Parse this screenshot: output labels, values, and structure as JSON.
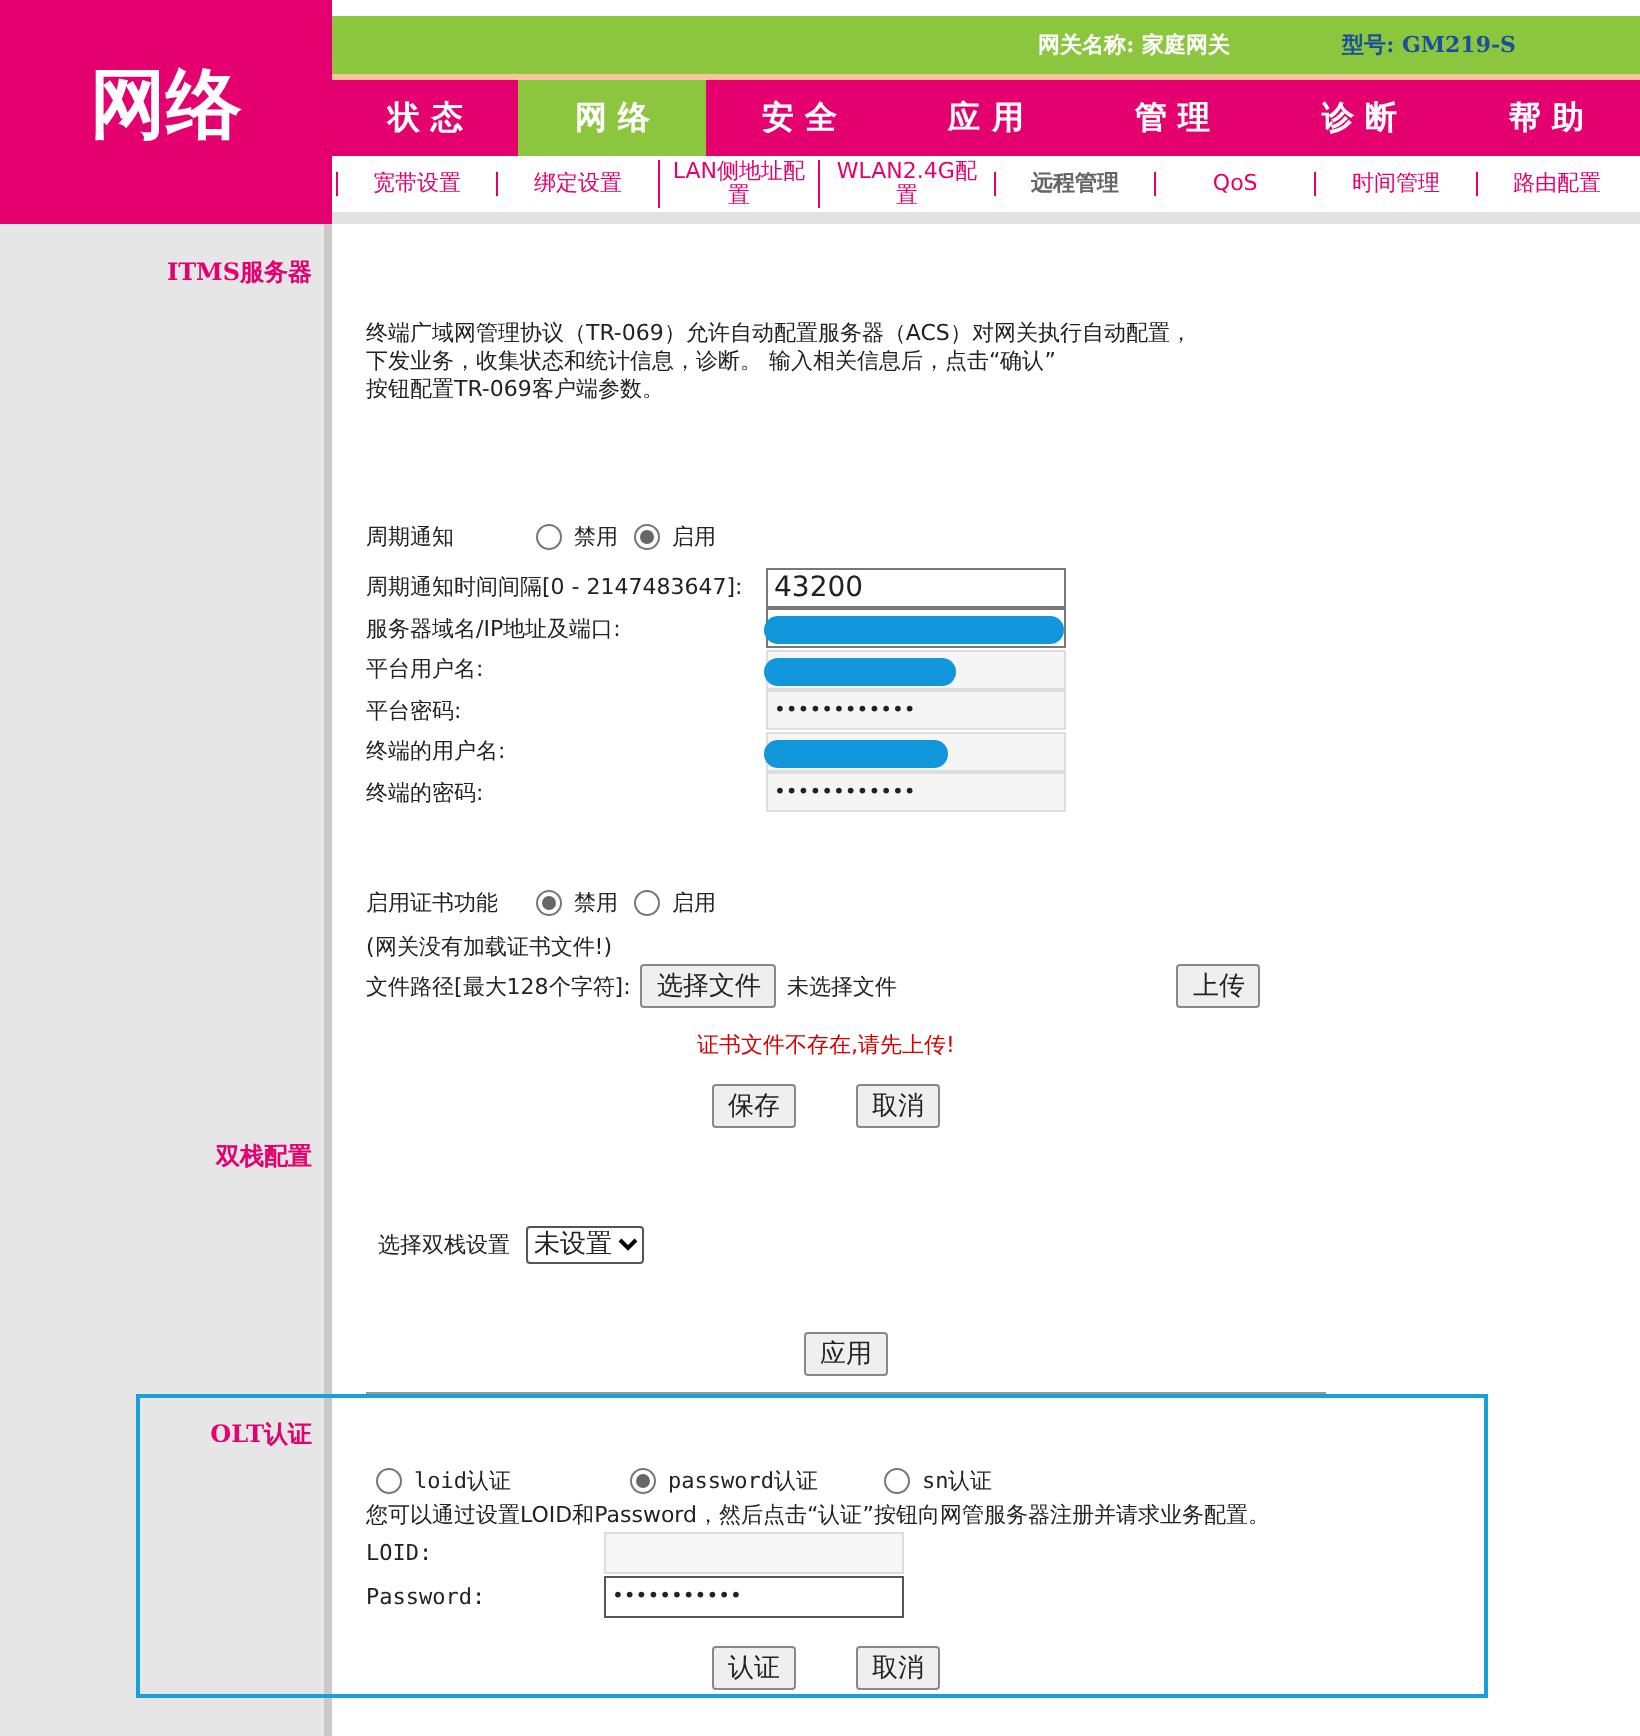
{
  "logo": "网络",
  "gateway": {
    "name": "网关名称: 家庭网关",
    "model": "型号: GM219-S"
  },
  "tabs": [
    {
      "label": "状 态",
      "selected": false
    },
    {
      "label": "网 络",
      "selected": true
    },
    {
      "label": "安 全",
      "selected": false
    },
    {
      "label": "应 用",
      "selected": false
    },
    {
      "label": "管 理",
      "selected": false
    },
    {
      "label": "诊 断",
      "selected": false
    },
    {
      "label": "帮 助",
      "selected": false
    }
  ],
  "subnav": [
    {
      "label": "宽带设置",
      "selected": false
    },
    {
      "label": "绑定设置",
      "selected": false
    },
    {
      "label": "LAN侧地址配置",
      "selected": false
    },
    {
      "label": "WLAN2.4G配置",
      "selected": false
    },
    {
      "label": "远程管理",
      "selected": true
    },
    {
      "label": "QoS",
      "selected": false
    },
    {
      "label": "时间管理",
      "selected": false
    },
    {
      "label": "路由配置",
      "selected": false
    }
  ],
  "itms": {
    "title": "ITMS服务器",
    "description_lines": [
      "终端广域网管理协议（TR-069）允许自动配置服务器（ACS）对网关执行自动配置，",
      "下发业务，收集状态和统计信息，诊断。 输入相关信息后，点击“确认”",
      "按钮配置TR-069客户端参数。"
    ],
    "periodic": {
      "label": "周期通知",
      "options": [
        {
          "label": "禁用",
          "selected": false
        },
        {
          "label": "启用",
          "selected": true
        }
      ]
    },
    "fields": [
      {
        "label": "周期通知时间间隔[0 - 2147483647]:",
        "value": "43200",
        "redacted": false,
        "kind": "plain"
      },
      {
        "label": "服务器域名/IP地址及端口:",
        "redacted": true,
        "kind": "plain"
      },
      {
        "label": "平台用户名:",
        "redacted": true,
        "kind": "shaded"
      },
      {
        "label": "平台密码:",
        "value": "••••••••••••",
        "redacted": false,
        "kind": "shaded"
      },
      {
        "label": "终端的用户名:",
        "redacted": true,
        "kind": "shaded"
      },
      {
        "label": "终端的密码:",
        "value": "••••••••••••",
        "redacted": false,
        "kind": "shaded"
      }
    ],
    "cert": {
      "label": "启用证书功能",
      "options": [
        {
          "label": "禁用",
          "selected": true
        },
        {
          "label": "启用",
          "selected": false
        }
      ]
    },
    "cert_note": "(网关没有加载证书文件!)",
    "file_label": "文件路径[最大128个字符]:",
    "choose_button": "选择文件",
    "no_file": "未选择文件",
    "upload_button": "上传",
    "error": "证书文件不存在,请先上传!",
    "buttons": [
      "保存",
      "取消"
    ]
  },
  "dual_stack": {
    "title": "双栈配置",
    "label": "选择双栈设置",
    "select_value": "未设置",
    "button": "应用"
  },
  "olt": {
    "title": "OLT认证",
    "highlighted": true,
    "options": [
      {
        "label": "loid认证",
        "selected": false
      },
      {
        "label": "password认证",
        "selected": true
      },
      {
        "label": "sn认证",
        "selected": false
      }
    ],
    "description": "您可以通过设置LOID和Password，然后点击“认证”按钮向网管服务器注册并请求业务配置。",
    "fields": [
      {
        "label": "LOID:",
        "disabled": true
      },
      {
        "label": "Password:",
        "value": "•••••••••••",
        "disabled": false
      }
    ],
    "buttons": [
      "认证",
      "取消"
    ]
  }
}
